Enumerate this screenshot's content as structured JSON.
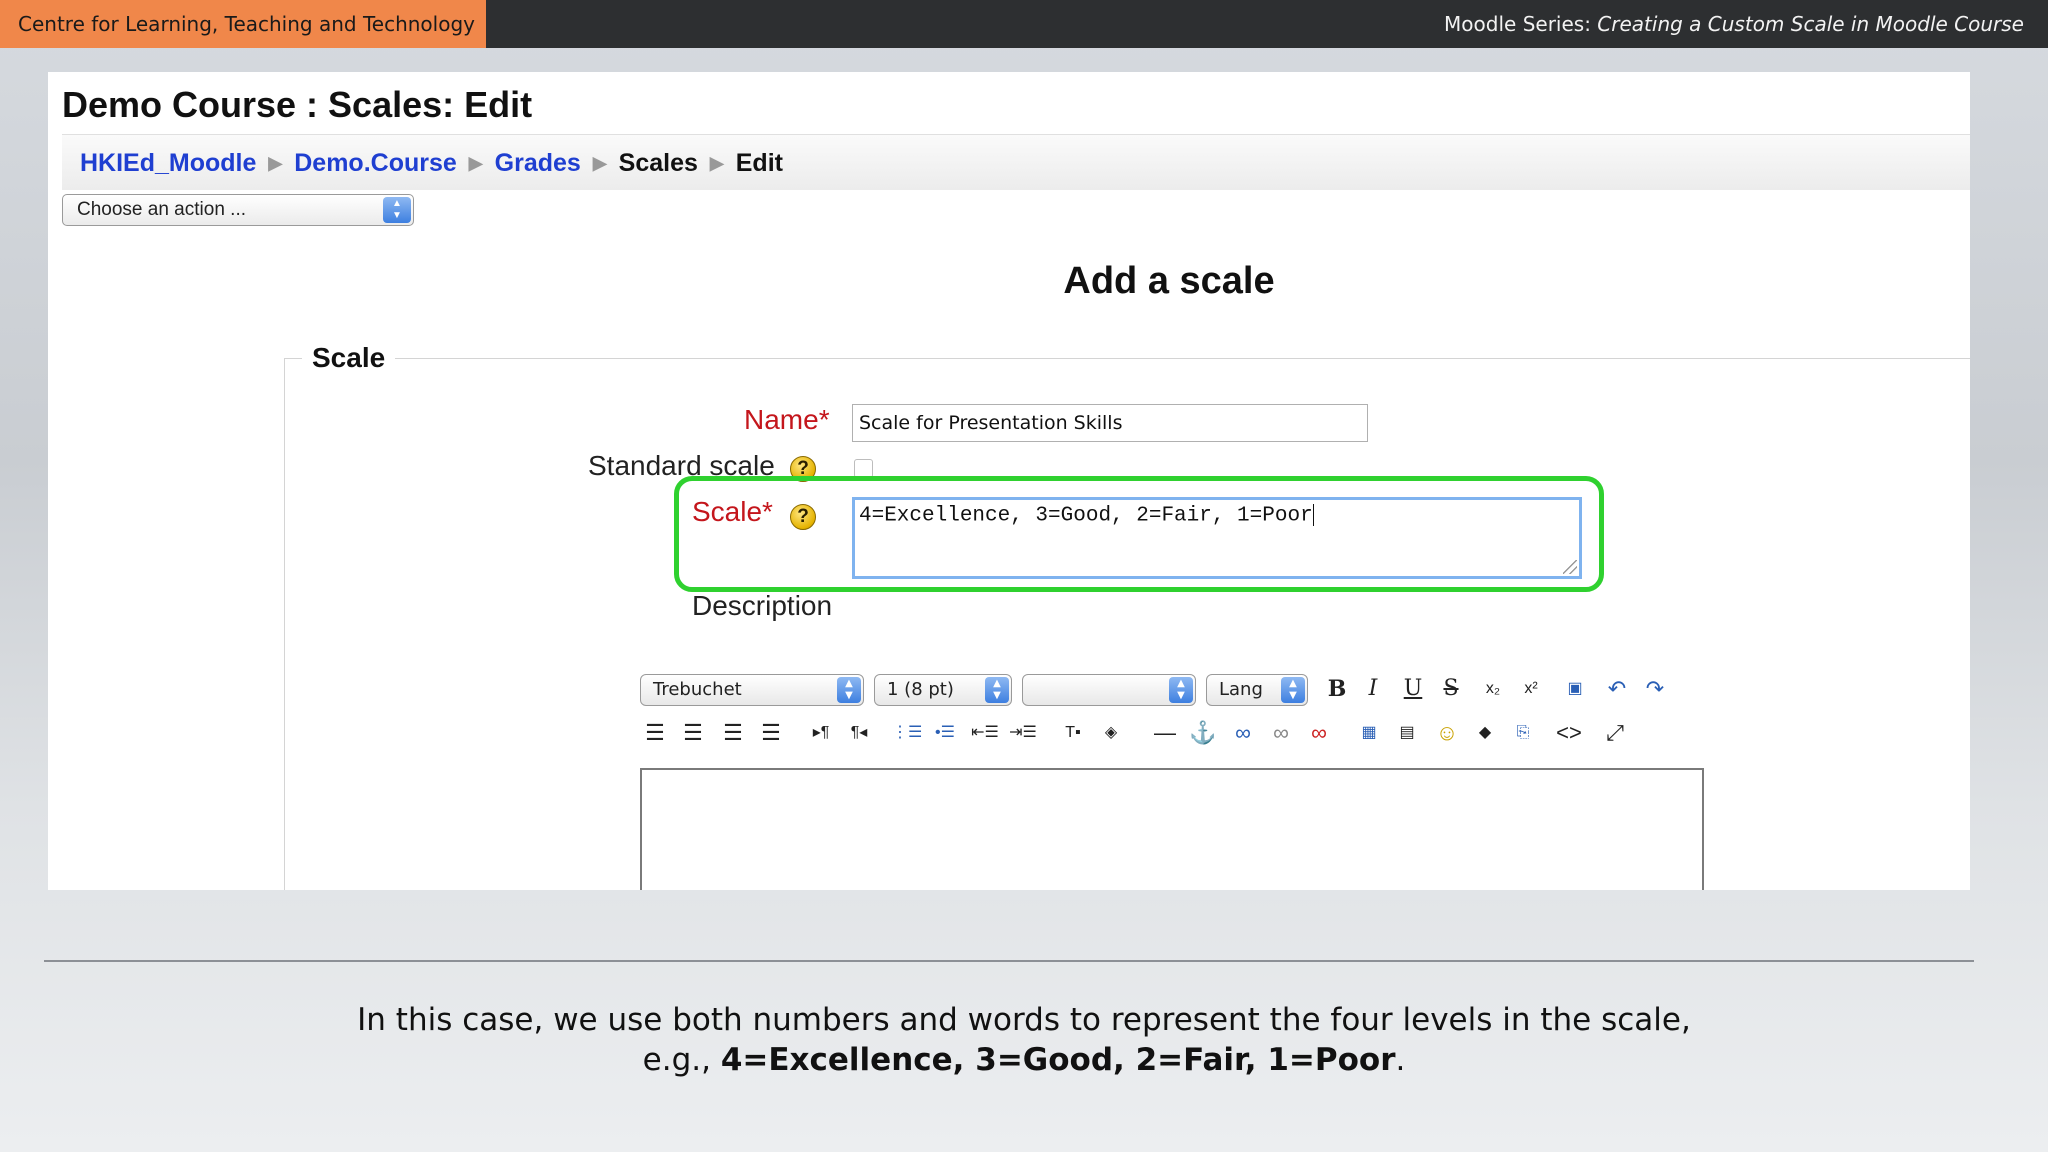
{
  "slide": {
    "org_tag": "Centre for Learning, Teaching and Technology",
    "series_prefix": "Moodle Series: ",
    "series_title": "Creating a Custom Scale in Moodle Course",
    "caption_line1": "In this case, we use both numbers and words to represent the four levels in the scale,",
    "caption_line2_prefix": "e.g., ",
    "caption_line2_bold": "4=Excellence, 3=Good, 2=Fair, 1=Poor",
    "caption_line2_suffix": ".",
    "colors": {
      "org_tag_bg": "#f0874a",
      "highlight": "#2fd12f",
      "required_label": "#c4161c",
      "link": "#1f3fd1"
    }
  },
  "page": {
    "title": "Demo Course : Scales: Edit",
    "breadcrumb": {
      "items": [
        "HKIEd_Moodle",
        "Demo.Course",
        "Grades",
        "Scales",
        "Edit"
      ],
      "separator": "▶"
    },
    "action_select": {
      "selected": "Choose an action ..."
    }
  },
  "form": {
    "heading": "Add a scale",
    "legend": "Scale",
    "name_label": "Name",
    "name_value": "Scale for Presentation Skills",
    "standard_scale_label": "Standard scale",
    "standard_scale_checked": false,
    "scale_label": "Scale",
    "scale_value": "4=Excellence, 3=Good, 2=Fair, 1=Poor",
    "required_mark": "*",
    "help_glyph": "?",
    "description_label": "Description"
  },
  "editor": {
    "font_select": "Trebuchet",
    "size_select": "1 (8 pt)",
    "format_select": "",
    "lang_select": "Lang",
    "bold": "B",
    "italic": "I",
    "underline": "U",
    "strike": "S",
    "icons": [
      "subscript-icon",
      "superscript-icon",
      "paste-word-icon",
      "undo-icon",
      "redo-icon",
      "align-left-icon",
      "align-center-icon",
      "align-right-icon",
      "justify-icon",
      "ltr-icon",
      "rtl-icon",
      "ordered-list-icon",
      "unordered-list-icon",
      "outdent-icon",
      "indent-icon",
      "text-color-icon",
      "background-color-icon",
      "horizontal-rule-icon",
      "anchor-icon",
      "link-icon",
      "unlink-icon",
      "nolink-icon",
      "image-icon",
      "table-icon",
      "smiley-icon",
      "special-char-icon",
      "search-replace-icon",
      "html-source-icon",
      "fullscreen-icon"
    ]
  }
}
